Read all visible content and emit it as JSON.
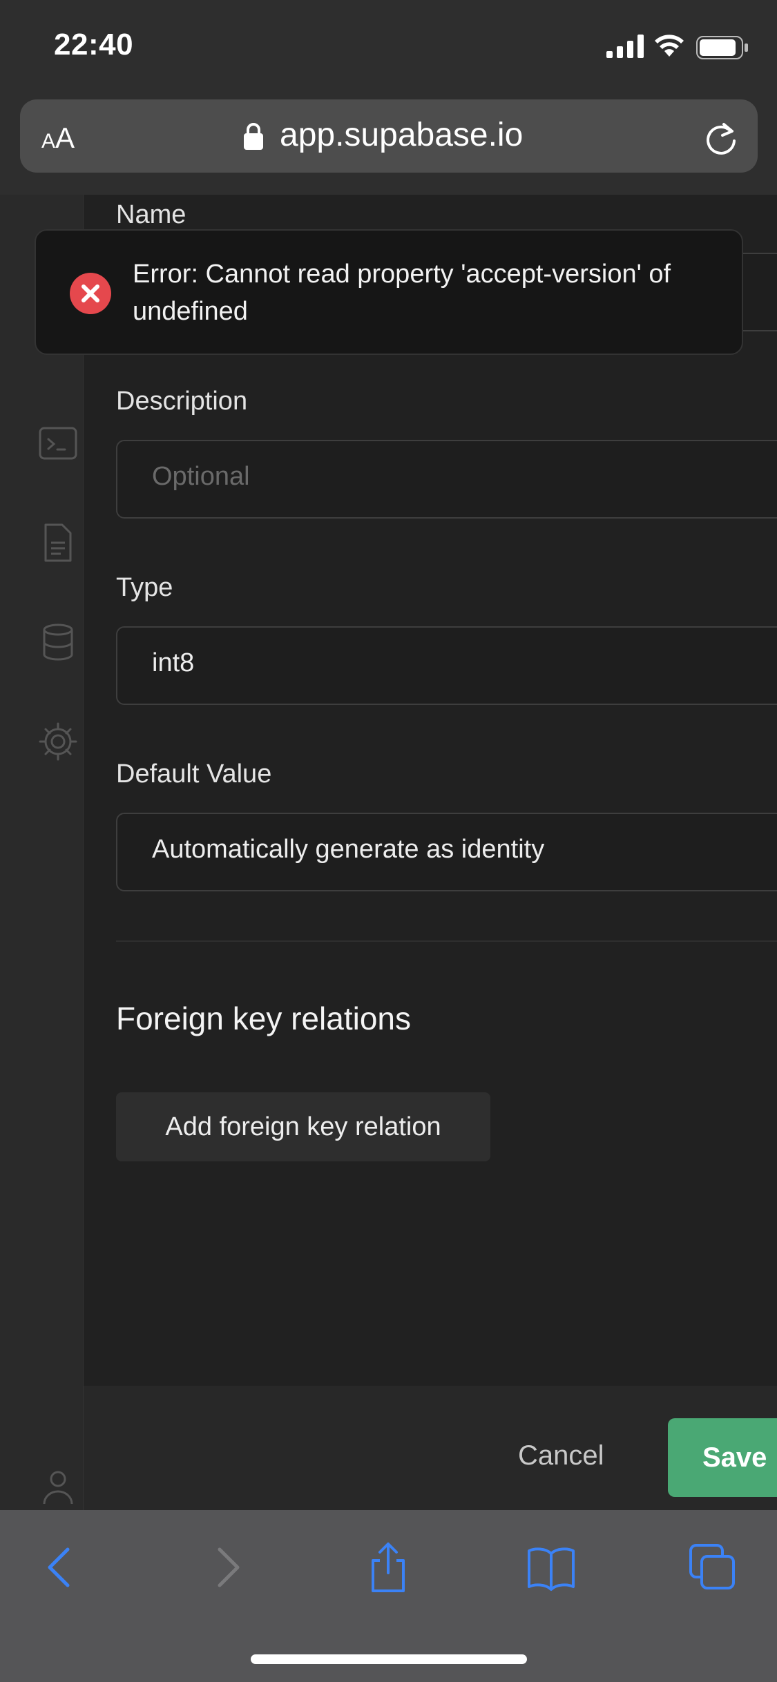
{
  "status_bar": {
    "time": "22:40",
    "icons": [
      "cellular-signal-icon",
      "wifi-icon",
      "battery-icon"
    ]
  },
  "browser": {
    "text_size_label_small": "A",
    "text_size_label_large": "A",
    "url": "app.supabase.io",
    "icons": [
      "lock-icon",
      "reload-icon"
    ]
  },
  "sidebar": {
    "icons": [
      "terminal-icon",
      "document-icon",
      "database-icon",
      "gear-icon",
      "user-icon"
    ]
  },
  "form": {
    "name_label": "Name",
    "description_label": "Description",
    "description_placeholder": "Optional",
    "type_label": "Type",
    "type_value": "int8",
    "default_label": "Default Value",
    "default_value": "Automatically generate as identity"
  },
  "foreign_keys": {
    "title": "Foreign key relations",
    "add_button": "Add foreign key relation"
  },
  "footer": {
    "cancel": "Cancel",
    "save": "Save"
  },
  "toast": {
    "message": "Error: Cannot read property 'accept-version' of undefined",
    "icon": "error-circle-icon"
  },
  "bottom_toolbar": {
    "icons": [
      "back-icon",
      "forward-icon",
      "share-icon",
      "bookmarks-icon",
      "tabs-icon"
    ]
  },
  "colors": {
    "accent": "#4aa874",
    "error": "#e5484d",
    "ios_blue": "#3b82f6"
  }
}
